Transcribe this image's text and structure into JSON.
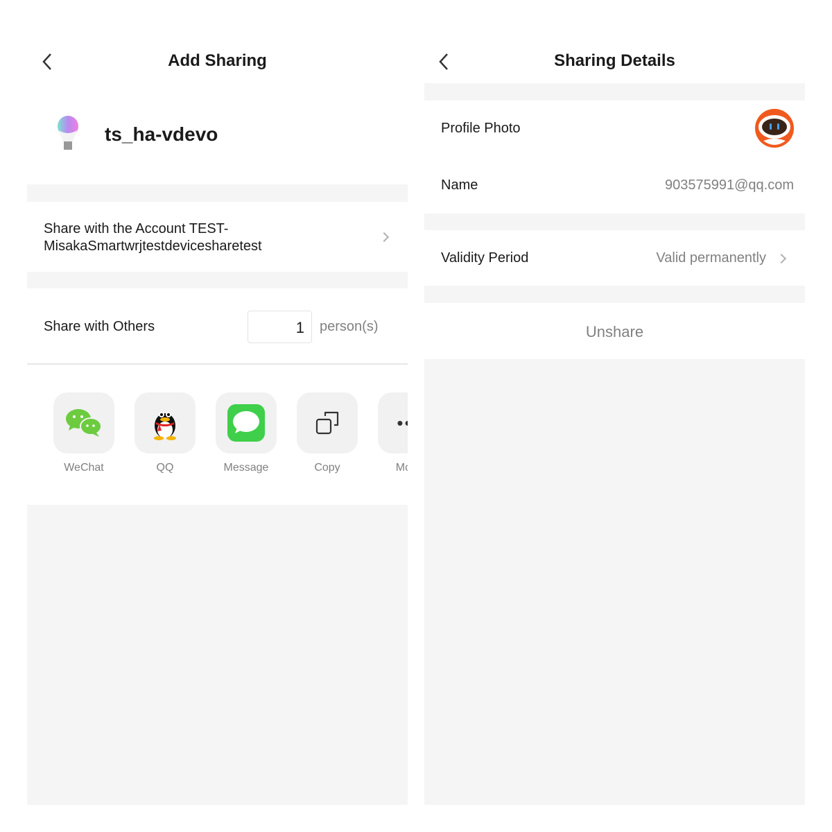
{
  "left": {
    "title": "Add Sharing",
    "device_name": "ts_ha-vdevo",
    "account_share_label": "Share with the Account TEST-MisakaSmartwrjtestdevicesharetest",
    "share_others_label": "Share with Others",
    "person_count": "1",
    "person_unit": "person(s)",
    "share_options": [
      {
        "label": "WeChat",
        "icon": "wechat-icon"
      },
      {
        "label": "QQ",
        "icon": "qq-penguin-icon"
      },
      {
        "label": "Message",
        "icon": "message-icon"
      },
      {
        "label": "Copy",
        "icon": "copy-icon"
      },
      {
        "label": "More",
        "icon": "more-icon"
      }
    ]
  },
  "right": {
    "title": "Sharing Details",
    "profile_photo_label": "Profile Photo",
    "name_label": "Name",
    "name_value": "903575991@qq.com",
    "validity_label": "Validity Period",
    "validity_value": "Valid permanently",
    "unshare_label": "Unshare"
  },
  "colors": {
    "wechat": "#6ccb3f",
    "message": "#3fcf4b",
    "avatar": "#f05a1e",
    "section_gray": "#f5f5f5"
  }
}
